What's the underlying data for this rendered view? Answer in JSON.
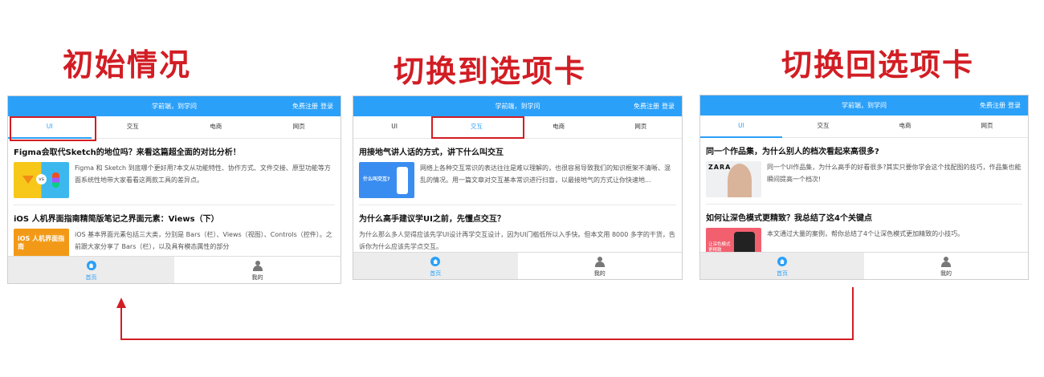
{
  "captions": {
    "initial": "初始情况",
    "switch_to": "切换到选项卡",
    "switch_back": "切换回选项卡"
  },
  "colors": {
    "accent": "#2ba0f8",
    "highlight": "#d21d24"
  },
  "header": {
    "slogan": "学前端，到学问",
    "register": "免费注册",
    "login": "登录"
  },
  "tabs": [
    "UI",
    "交互",
    "电商",
    "网页"
  ],
  "bottom_nav": {
    "home": "首页",
    "mine": "我的"
  },
  "icons": {
    "home": "home-icon",
    "mine": "user-icon"
  },
  "panels": [
    {
      "active_tab": "UI",
      "articles": [
        {
          "title": "Figma会取代Sketch的地位吗？来看这篇超全面的对比分析！",
          "desc": "Figma 和 Sketch 到底哪个更好用?本文从功能特性、协作方式、文件交接、原型功能等方面系统性地带大家看看这两款工具的差异点。",
          "thumb_text": "vs"
        },
        {
          "title": "iOS 人机界面指南精简版笔记之界面元素：Views（下）",
          "desc": "iOS 基本界面元素包括三大类，分别是 Bars（栏）、Views（视图）、Controls（控件）。之前跟大家分享了 Bars（栏），以及具有模态属性的部分",
          "thumb_text": "iOS 人机界面指南"
        }
      ]
    },
    {
      "active_tab": "交互",
      "articles": [
        {
          "title": "用接地气讲人话的方式，讲下什么叫交互",
          "desc": "网络上各种交互常识的表达往往是难以理解的，也很容易导致我们的知识框架不清晰、混乱的情况。用一篇文章对交互基本常识进行扫盲，以最接地气的方式让你快速地...",
          "thumb_text": "什么叫交互?"
        },
        {
          "title": "为什么高手建议学UI之前，先懂点交互？",
          "desc": "为什么那么多人觉得应该先学UI设计再学交互设计，因为UI门槛低所以入手快。但本文用 8000 多字的干货，告诉你为什么应该先学点交互。"
        }
      ]
    },
    {
      "active_tab": "UI",
      "articles": [
        {
          "title": "同一个作品集，为什么别人的档次看起来高很多?",
          "desc": "同一个UI作品集，为什么高手的好看很多?其实只要你学会这个找配图的技巧，作品集也能瞬间提高一个档次!",
          "thumb_text": "ZARA"
        },
        {
          "title": "如何让深色模式更精致？我总结了这4个关键点",
          "desc": "本文通过大量的案例，帮你总结了4个让深色模式更加精致的小技巧。",
          "thumb_text": "让深色模式更精致"
        }
      ]
    }
  ]
}
